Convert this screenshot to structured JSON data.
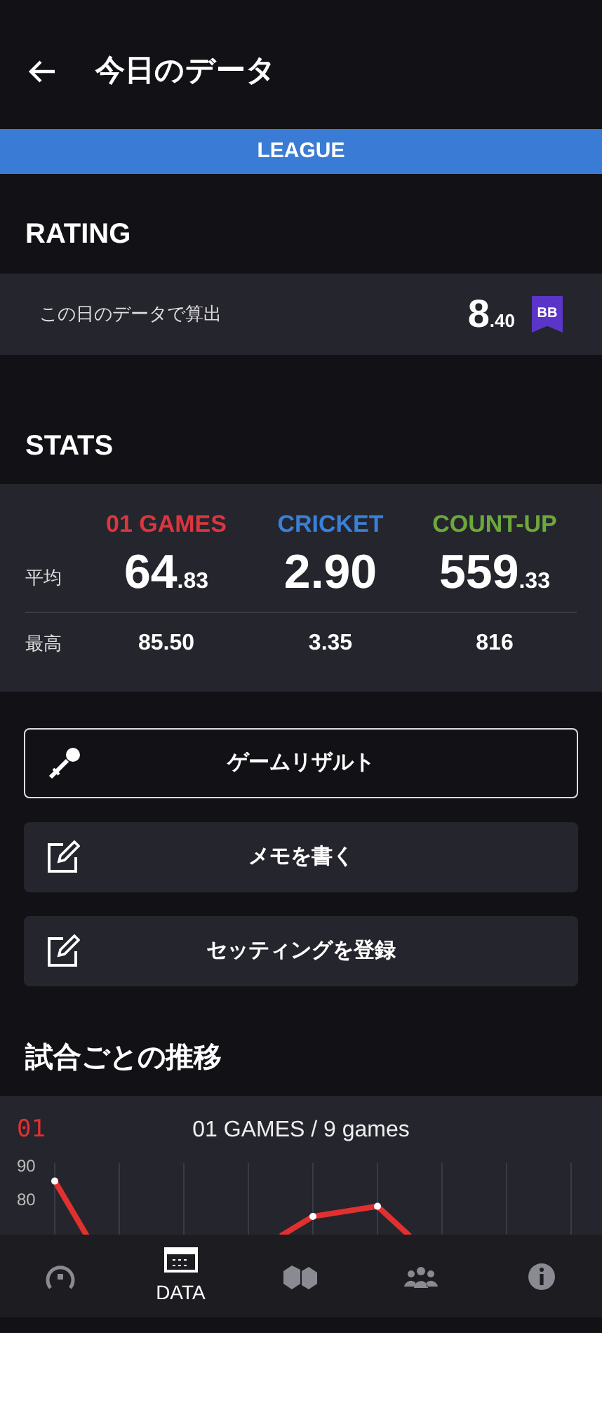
{
  "header": {
    "title": "今日のデータ"
  },
  "mode_bar": {
    "label": "LEAGUE"
  },
  "rating": {
    "heading": "RATING",
    "label": "この日のデータで算出",
    "integer": "8",
    "fraction": ".40",
    "badge": "BB",
    "color": "#5a35c8"
  },
  "stats": {
    "heading": "STATS",
    "row_labels": [
      "平均",
      "最高"
    ],
    "columns": [
      {
        "name": "01 GAMES",
        "color": "#d9363e",
        "average_integer": "64",
        "average_fraction": ".83",
        "best": "85.50"
      },
      {
        "name": "CRICKET",
        "color": "#3a7fd8",
        "average_integer": "2.90",
        "best": "3.35"
      },
      {
        "name": "COUNT-UP",
        "color": "#6ea83a",
        "average_integer": "559",
        "average_fraction": ".33",
        "best": "816"
      }
    ]
  },
  "actions": [
    {
      "label": "ゲームリザルト",
      "kind": "outlined"
    },
    {
      "label": "メモを書く",
      "kind": "filled"
    },
    {
      "label": "セッティングを登録",
      "kind": "filled"
    }
  ],
  "trend": {
    "heading": "試合ごとの推移",
    "badge": "01",
    "title": "01 GAMES / 9 games",
    "y_axis_labels": [
      "90",
      "80"
    ]
  },
  "nav": [
    {
      "kind": "gauge",
      "selected": false
    },
    {
      "kind": "data",
      "label": "DATA",
      "selected": true
    },
    {
      "kind": "stats",
      "selected": false
    },
    {
      "kind": "people",
      "selected": false
    },
    {
      "kind": "info",
      "selected": false
    }
  ]
}
